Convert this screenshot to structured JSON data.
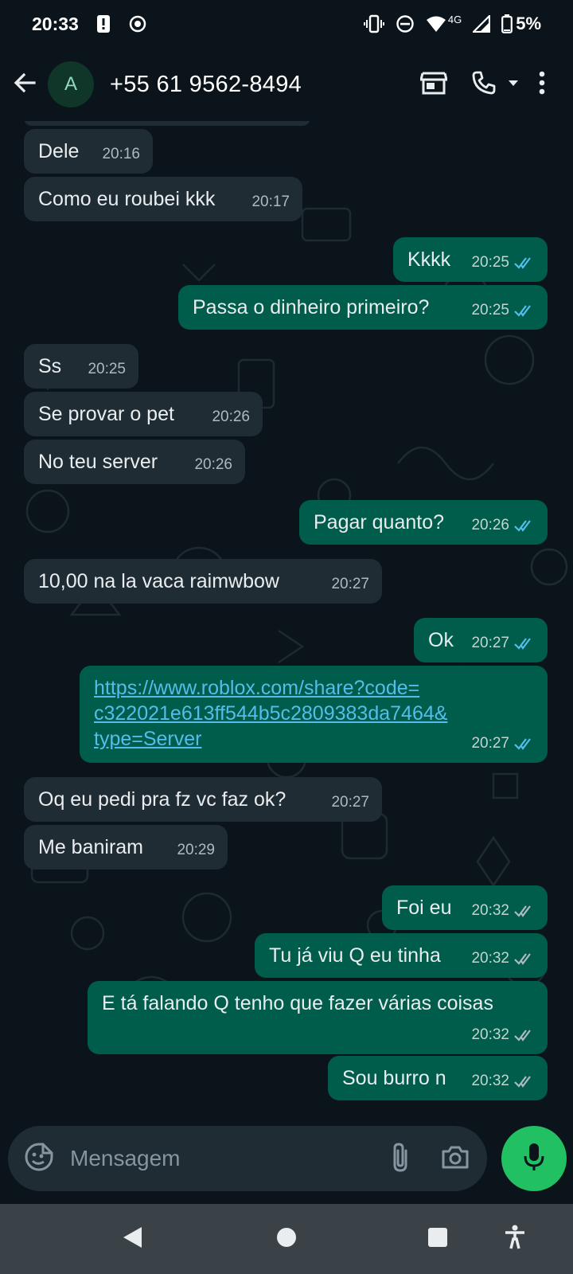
{
  "status_bar": {
    "time": "20:33",
    "network": "4G",
    "battery": "5%"
  },
  "header": {
    "avatar_letter": "A",
    "contact": "+55 61 9562-8494"
  },
  "messages": [
    {
      "dir": "in",
      "text": "Dele",
      "time": "20:16"
    },
    {
      "dir": "in",
      "text": "Como eu roubei kkk",
      "time": "20:17"
    },
    {
      "dir": "out",
      "text": "Kkkk",
      "time": "20:25",
      "status": "read"
    },
    {
      "dir": "out",
      "text": "Passa o dinheiro primeiro?",
      "time": "20:25",
      "status": "read"
    },
    {
      "dir": "in",
      "text": "Ss",
      "time": "20:25"
    },
    {
      "dir": "in",
      "text": "Se provar o pet",
      "time": "20:26"
    },
    {
      "dir": "in",
      "text": "No teu server",
      "time": "20:26"
    },
    {
      "dir": "out",
      "text": "Pagar quanto?",
      "time": "20:26",
      "status": "read"
    },
    {
      "dir": "in",
      "text": "10,00 na la vaca raimwbow",
      "time": "20:27"
    },
    {
      "dir": "out",
      "text": "Ok",
      "time": "20:27",
      "status": "read"
    },
    {
      "dir": "out",
      "text": "https://www.roblox.com/share?code=c322021e613ff544b5c2809383da7464&type=Server",
      "time": "20:27",
      "status": "read",
      "link": true
    },
    {
      "dir": "in",
      "text": "Oq eu pedi pra fz vc faz ok?",
      "time": "20:27"
    },
    {
      "dir": "in",
      "text": "Me baniram",
      "time": "20:29"
    },
    {
      "dir": "out",
      "text": "Foi eu",
      "time": "20:32",
      "status": "delivered"
    },
    {
      "dir": "out",
      "text": "Tu já viu Q eu tinha",
      "time": "20:32",
      "status": "delivered"
    },
    {
      "dir": "out",
      "text": "E tá falando Q tenho que fazer várias coisas",
      "time": "20:32",
      "status": "delivered"
    },
    {
      "dir": "out",
      "text": "Sou burro n",
      "time": "20:32",
      "status": "delivered"
    }
  ],
  "link_lines": [
    "https://www.roblox.com/share?code=",
    "c322021e613ff544b5c2809383da7464&",
    "type=Server"
  ],
  "composer": {
    "placeholder": "Mensagem"
  },
  "icons": {
    "back": "arrow-left-icon",
    "store": "store-icon",
    "call": "phone-icon",
    "more": "more-vertical-icon",
    "emoji": "emoji-icon",
    "attach": "paperclip-icon",
    "camera": "camera-icon",
    "mic": "microphone-icon"
  },
  "colors": {
    "background": "#0b141a",
    "incoming_bubble": "#202c33",
    "outgoing_bubble": "#005c4b",
    "read_tick": "#53bdeb",
    "mic_button": "#21c063"
  }
}
